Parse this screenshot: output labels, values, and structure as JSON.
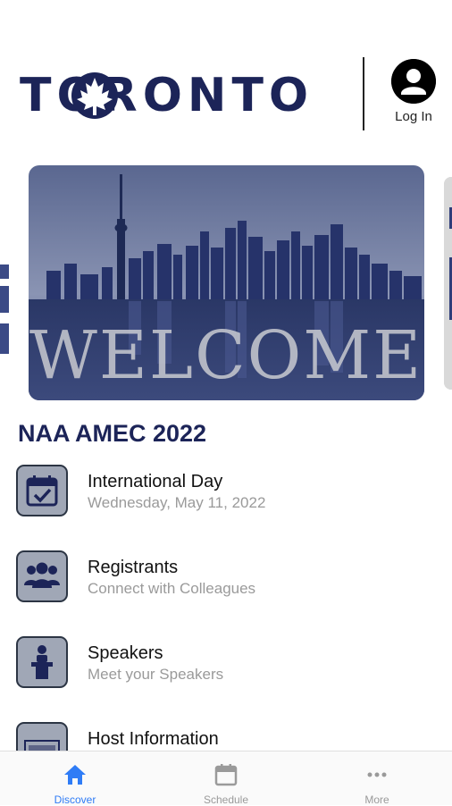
{
  "header": {
    "logo_text": "TORONTO",
    "login_label": "Log In"
  },
  "carousel": {
    "main_text": "WELCOME",
    "tint_color": "#2f3d7a"
  },
  "section": {
    "title": "NAA AMEC 2022",
    "items": [
      {
        "title": "International Day",
        "subtitle": "Wednesday, May 11, 2022",
        "icon": "calendar-check-icon"
      },
      {
        "title": "Registrants",
        "subtitle": "Connect with Colleagues",
        "icon": "group-icon"
      },
      {
        "title": "Speakers",
        "subtitle": "Meet your Speakers",
        "icon": "podium-icon"
      },
      {
        "title": "Host Information",
        "subtitle": "",
        "icon": "welcome-sign-icon"
      }
    ]
  },
  "tabbar": {
    "tabs": [
      {
        "label": "Discover",
        "icon": "home-icon",
        "active": true
      },
      {
        "label": "Schedule",
        "icon": "calendar-icon",
        "active": false
      },
      {
        "label": "More",
        "icon": "more-dots-icon",
        "active": false
      }
    ]
  },
  "colors": {
    "brand_navy": "#1c2458",
    "active_tab": "#2f7cf6",
    "inactive_tab": "#9a9a9a",
    "tile_fill": "#a0a7b6"
  }
}
